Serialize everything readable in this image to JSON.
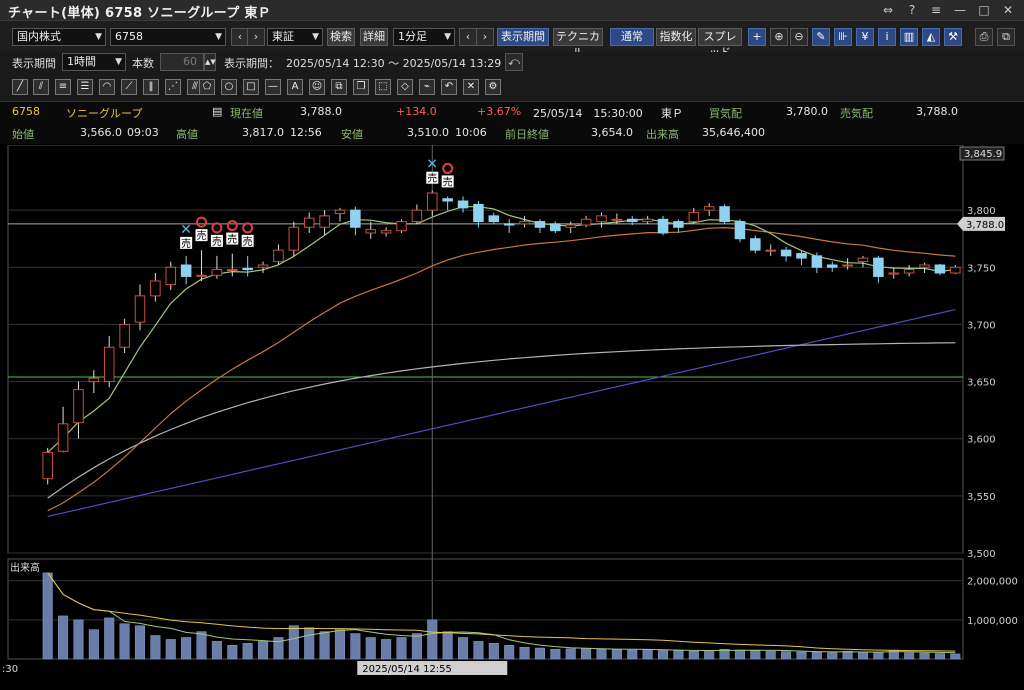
{
  "window": {
    "title": "チャート(単体) 6758 ソニーグループ 東Ｐ",
    "controls": [
      "⇔",
      "?",
      "≡",
      "—",
      "□",
      "✕"
    ]
  },
  "toolbar1": {
    "market_select": "国内株式",
    "code_input": "6758",
    "exchange_select": "東証",
    "search_button": "検索",
    "detail_button": "詳細",
    "interval_select": "1分足",
    "display_period_button": "表示期間",
    "technical_button": "テクニカル",
    "normal_button": "通常",
    "index_button": "指数化",
    "spread_button": "スプレッド"
  },
  "toolbar2": {
    "period_label": "表示期間",
    "period_select": "1時間",
    "count_label": "本数",
    "count_value": "60",
    "range_label": "表示期間：",
    "range_value": "2025/05/14 12:30 ～ 2025/05/14 13:29"
  },
  "info": {
    "code": "6758",
    "name": "ソニーグループ",
    "current_label": "現在値",
    "current": "3,788.0",
    "change": "+134.0",
    "change_pct": "+3.67%",
    "datetime": "25/05/14　15:30:00",
    "market": "東Ｐ",
    "bid_label": "買気配",
    "bid": "3,780.0",
    "ask_label": "売気配",
    "ask": "3,788.0",
    "open_label": "始値",
    "open": "3,566.0",
    "open_time": "09:03",
    "high_label": "高値",
    "high": "3,817.0",
    "high_time": "12:56",
    "low_label": "安値",
    "low": "3,510.0",
    "low_time": "10:06",
    "prev_label": "前日終値",
    "prev": "3,654.0",
    "volume_label": "出来高",
    "volume": "35,646,400"
  },
  "chart_data": {
    "type": "candlestick",
    "price_axis": {
      "ylim": [
        3500,
        3850
      ],
      "ticks": [
        "3,800",
        "3,750",
        "3,700",
        "3,650",
        "3,600",
        "3,550",
        "3,500"
      ],
      "top_label": "3,845.9",
      "current_label": "3,788.0",
      "current_value": 3788
    },
    "reference_line": 3654,
    "candles": [
      [
        3565,
        3588,
        3592,
        3560
      ],
      [
        3589,
        3613,
        3628,
        3588
      ],
      [
        3614,
        3643,
        3650,
        3600
      ],
      [
        3650,
        3653,
        3660,
        3640
      ],
      [
        3650,
        3680,
        3690,
        3645
      ],
      [
        3680,
        3700,
        3705,
        3675
      ],
      [
        3702,
        3725,
        3735,
        3695
      ],
      [
        3725,
        3738,
        3745,
        3720
      ],
      [
        3735,
        3750,
        3755,
        3730
      ],
      [
        3752,
        3742,
        3760,
        3735
      ],
      [
        3743,
        3743,
        3765,
        3738
      ],
      [
        3743,
        3748,
        3760,
        3740
      ],
      [
        3748,
        3748,
        3762,
        3742
      ],
      [
        3749,
        3748,
        3760,
        3742
      ],
      [
        3750,
        3752,
        3755,
        3745
      ],
      [
        3755,
        3765,
        3770,
        3752
      ],
      [
        3765,
        3785,
        3790,
        3760
      ],
      [
        3785,
        3793,
        3798,
        3780
      ],
      [
        3785,
        3795,
        3800,
        3778
      ],
      [
        3797,
        3800,
        3802,
        3790
      ],
      [
        3800,
        3785,
        3803,
        3778
      ],
      [
        3780,
        3783,
        3790,
        3775
      ],
      [
        3780,
        3782,
        3785,
        3777
      ],
      [
        3782,
        3790,
        3792,
        3780
      ],
      [
        3790,
        3800,
        3805,
        3788
      ],
      [
        3800,
        3815,
        3817,
        3795
      ],
      [
        3810,
        3808,
        3812,
        3800
      ],
      [
        3808,
        3802,
        3812,
        3798
      ],
      [
        3805,
        3790,
        3808,
        3785
      ],
      [
        3795,
        3790,
        3798,
        3788
      ],
      [
        3788,
        3787,
        3792,
        3780
      ],
      [
        3788,
        3790,
        3795,
        3785
      ],
      [
        3790,
        3785,
        3792,
        3780
      ],
      [
        3788,
        3782,
        3790,
        3780
      ],
      [
        3785,
        3787,
        3790,
        3780
      ],
      [
        3787,
        3792,
        3795,
        3785
      ],
      [
        3790,
        3795,
        3798,
        3785
      ],
      [
        3792,
        3792,
        3797,
        3788
      ],
      [
        3792,
        3790,
        3795,
        3787
      ],
      [
        3790,
        3792,
        3795,
        3788
      ],
      [
        3792,
        3780,
        3795,
        3778
      ],
      [
        3790,
        3785,
        3792,
        3780
      ],
      [
        3790,
        3798,
        3802,
        3788
      ],
      [
        3800,
        3803,
        3806,
        3795
      ],
      [
        3803,
        3790,
        3805,
        3788
      ],
      [
        3790,
        3775,
        3792,
        3772
      ],
      [
        3775,
        3765,
        3778,
        3762
      ],
      [
        3765,
        3765,
        3770,
        3760
      ],
      [
        3765,
        3760,
        3768,
        3755
      ],
      [
        3762,
        3758,
        3765,
        3752
      ],
      [
        3760,
        3750,
        3763,
        3745
      ],
      [
        3752,
        3750,
        3755,
        3746
      ],
      [
        3752,
        3752,
        3758,
        3748
      ],
      [
        3755,
        3758,
        3760,
        3750
      ],
      [
        3758,
        3742,
        3760,
        3736
      ],
      [
        3744,
        3745,
        3750,
        3740
      ],
      [
        3745,
        3748,
        3752,
        3742
      ],
      [
        3750,
        3752,
        3754,
        3745
      ],
      [
        3752,
        3745,
        3753,
        3743
      ],
      [
        3745,
        3750,
        3752,
        3744
      ]
    ],
    "signals": [
      {
        "index": 9,
        "type": "cross"
      },
      {
        "index": 10,
        "type": "sell"
      },
      {
        "index": 11,
        "type": "sell"
      },
      {
        "index": 12,
        "type": "sell"
      },
      {
        "index": 13,
        "type": "sell"
      },
      {
        "index": 25,
        "type": "cross"
      },
      {
        "index": 26,
        "type": "sell"
      }
    ],
    "signal_label": "売",
    "volume_axis": {
      "ylim": [
        0,
        2400000
      ],
      "ticks": [
        "2,000,000",
        "1,000,000"
      ],
      "title": "出来高"
    },
    "volumes": [
      2200000,
      1100000,
      1000000,
      750000,
      1050000,
      900000,
      850000,
      600000,
      500000,
      550000,
      700000,
      450000,
      350000,
      400000,
      450000,
      550000,
      850000,
      800000,
      700000,
      750000,
      650000,
      550000,
      500000,
      550000,
      650000,
      1000000,
      700000,
      550000,
      450000,
      400000,
      350000,
      300000,
      280000,
      250000,
      260000,
      270000,
      250000,
      240000,
      230000,
      240000,
      220000,
      210000,
      200000,
      220000,
      250000,
      230000,
      210000,
      200000,
      190000,
      180000,
      170000,
      160000,
      200000,
      180000,
      170000,
      220000,
      160000,
      150000,
      140000,
      130000
    ],
    "x_labels": {
      "left": ":30",
      "crosshair": "2025/05/14 12:55"
    }
  },
  "colors": {
    "up": "#ffffff",
    "down": "#8fd2f0",
    "up_border": "#c8503c",
    "ma_short": "#a0c878",
    "ma_mid": "#c87838",
    "ma_long": "#5050c8",
    "ma_gray": "#b4b4b4",
    "ref_line": "#46c846",
    "sell_ring": "#e04040",
    "cross": "#5ab4e6"
  }
}
